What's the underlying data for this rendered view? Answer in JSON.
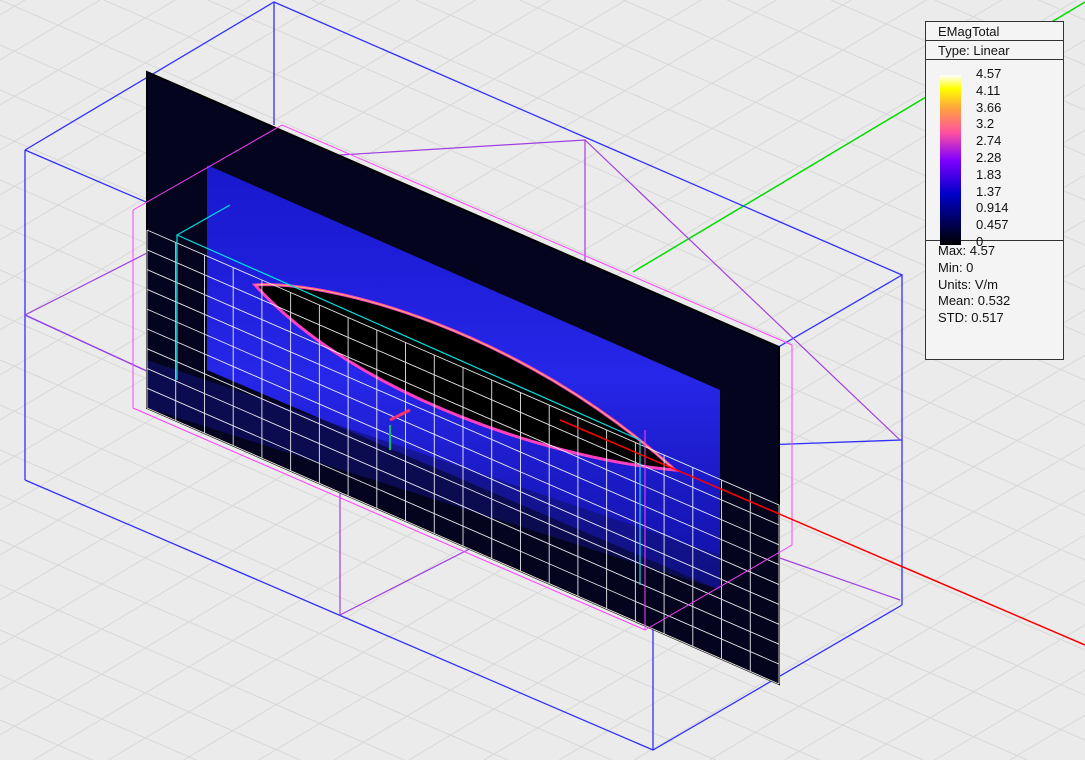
{
  "legend": {
    "title": "EMagTotal",
    "type": "Type: Linear",
    "ticks": [
      "4.57",
      "4.11",
      "3.66",
      "3.2",
      "2.74",
      "2.28",
      "1.83",
      "1.37",
      "0.914",
      "0.457",
      "0"
    ],
    "stats": [
      "Max: 4.57",
      "Min: 0",
      "Units: V/m",
      "Mean: 0.532",
      "STD: 0.517"
    ],
    "colormap": [
      "#000000",
      "#000050",
      "#0000c8",
      "#8000ff",
      "#ff50a0",
      "#ffa040",
      "#ffff00",
      "#ffffff"
    ]
  },
  "scene": {
    "axis_colors": {
      "x": "#ff0000",
      "y": "#00dd00",
      "z": "#0000ff"
    },
    "region_box_color": "#3030ff",
    "substrate_box_color": "#a040e0",
    "port_box_color": "#ff40ff"
  }
}
